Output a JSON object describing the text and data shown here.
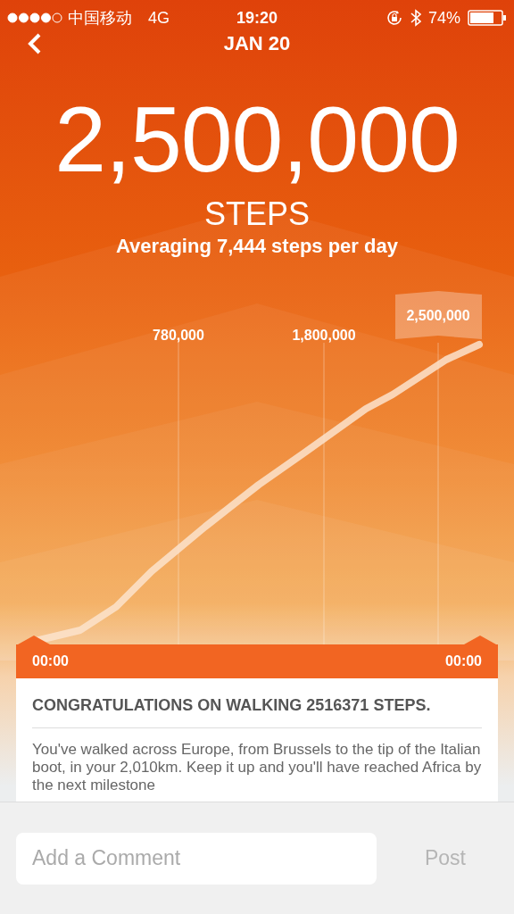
{
  "status_bar": {
    "carrier": "中国移动",
    "network": "4G",
    "time": "19:20",
    "battery": "74%"
  },
  "header": {
    "title": "JAN 20"
  },
  "summary": {
    "total": "2,500,000",
    "unit": "STEPS",
    "average": "Averaging 7,444 steps per day"
  },
  "chart": {
    "milestones": [
      {
        "label": "780,000",
        "selected": false
      },
      {
        "label": "1,800,000",
        "selected": false
      },
      {
        "label": "2,500,000",
        "selected": true
      }
    ]
  },
  "time_range": {
    "start": "00:00",
    "end": "00:00"
  },
  "card": {
    "title": "CONGRATULATIONS ON WALKING 2516371 STEPS.",
    "body": "You've walked across Europe, from Brussels to the tip of the Italian boot, in your 2,010km. Keep it up and you'll have reached Africa by the next milestone"
  },
  "comment": {
    "placeholder": "Add a Comment",
    "post": "Post",
    "post_disabled": true
  }
}
